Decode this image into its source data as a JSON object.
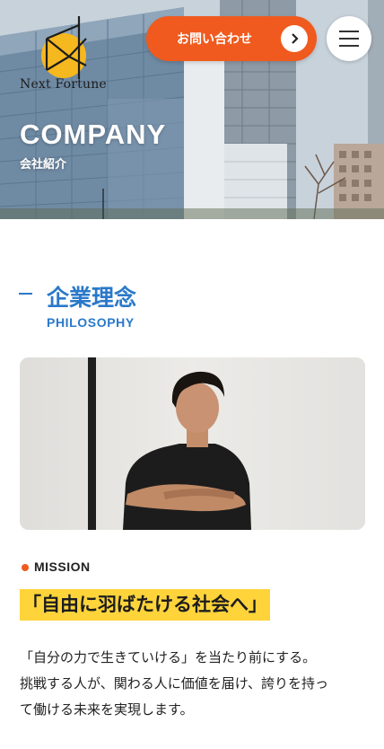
{
  "header": {
    "logo_text": "Next Fortune",
    "contact_label": "お問い合わせ",
    "icons": {
      "contact_arrow": "chevron-right-icon",
      "menu": "hamburger-menu-icon",
      "logo": "next-fortune-logo-icon"
    },
    "colors": {
      "accent": "#f05a1e",
      "menu_bg": "#ffffff"
    }
  },
  "hero": {
    "title": "COMPANY",
    "subtitle": "会社紹介"
  },
  "section": {
    "title": "企業理念",
    "title_en": "PHILOSOPHY",
    "color": "#2a79c9"
  },
  "mission": {
    "label": "MISSION",
    "title": "「自由に羽ばたける社会へ」",
    "highlight_color": "#ffd43b",
    "body": [
      "「自分の力で生きていける」を当たり前にする。",
      "挑戦する人が、関わる人に価値を届け、誇りを持っ",
      "て働ける未来を実現します。"
    ]
  }
}
